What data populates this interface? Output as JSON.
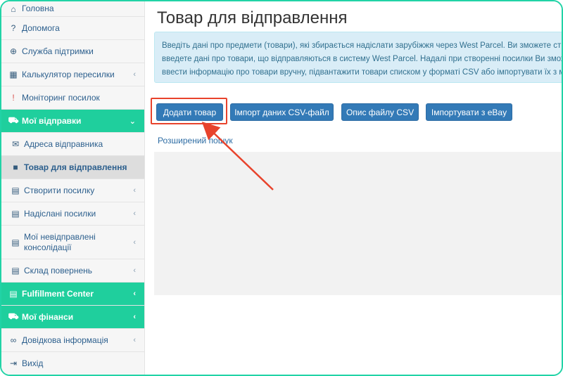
{
  "sidebar": {
    "items": [
      {
        "label": "Головна",
        "icon": "home-icon",
        "glyph": "⌂",
        "type": "item",
        "chevron": false
      },
      {
        "label": "Допомога",
        "icon": "question-icon",
        "glyph": "?",
        "type": "item",
        "chevron": false
      },
      {
        "label": "Служба підтримки",
        "icon": "lifebuoy-icon",
        "glyph": "⊕",
        "type": "item",
        "chevron": false
      },
      {
        "label": "Калькулятор пересилки",
        "icon": "calculator-icon",
        "glyph": "▦",
        "type": "item",
        "chevron": true
      },
      {
        "label": "Моніторинг посилок",
        "icon": "exclamation-icon",
        "glyph": "!",
        "type": "item",
        "chevron": false,
        "glyph_color": "#d9534f"
      },
      {
        "label": "Мої відправки",
        "icon": "cart-icon",
        "glyph": "⛟",
        "type": "section",
        "chevron": true,
        "chevron_glyph": "⌄"
      },
      {
        "label": "Адреса відправника",
        "icon": "envelope-icon",
        "glyph": "✉",
        "type": "sub",
        "chevron": false
      },
      {
        "label": "Товар для відправлення",
        "icon": "box-icon",
        "glyph": "■",
        "type": "active",
        "chevron": false
      },
      {
        "label": "Створити посилку",
        "icon": "list-icon",
        "glyph": "▤",
        "type": "sub",
        "chevron": true
      },
      {
        "label": "Надіслані посилки",
        "icon": "list-icon",
        "glyph": "▤",
        "type": "sub",
        "chevron": true
      },
      {
        "label": "Мої невідправлені консолідації",
        "icon": "list-icon",
        "glyph": "▤",
        "type": "sub",
        "chevron": true
      },
      {
        "label": "Склад повернень",
        "icon": "list-icon",
        "glyph": "▤",
        "type": "sub",
        "chevron": true
      },
      {
        "label": "Fulfillment Center",
        "icon": "list-icon",
        "glyph": "▤",
        "type": "section",
        "chevron": true
      },
      {
        "label": "Мої фінанси",
        "icon": "cart-icon",
        "glyph": "⛟",
        "type": "section",
        "chevron": true
      },
      {
        "label": "Довідкова інформація",
        "icon": "link-icon",
        "glyph": "∞",
        "type": "item",
        "chevron": true
      },
      {
        "label": "Вихід",
        "icon": "logout-icon",
        "glyph": "⇥",
        "type": "item",
        "chevron": false
      }
    ]
  },
  "main": {
    "title": "Товар для відправлення",
    "alert_lines": [
      "Введіть дані про предмети (товари), які збирається надіслати зарубіжжя через West Parcel. Ви зможете ст",
      "введете дані про товари, що відправляються в систему West Parcel. Надалі при створенні посилки Ви змож",
      "ввести інформацію про товари вручну, підвантажити товари списком у форматі CSV або імпортувати їх з м"
    ],
    "buttons": {
      "add": "Додати товар",
      "import_csv": "Імпорт даних CSV-файл",
      "csv_desc": "Опис файлу CSV",
      "ebay": "Імпортувати з eBay"
    },
    "advanced_search": "Розширений пошук"
  },
  "colors": {
    "accent": "#1fcf9d",
    "button": "#337ab7",
    "highlight": "#e8432c",
    "alert_bg": "#d9edf7"
  }
}
